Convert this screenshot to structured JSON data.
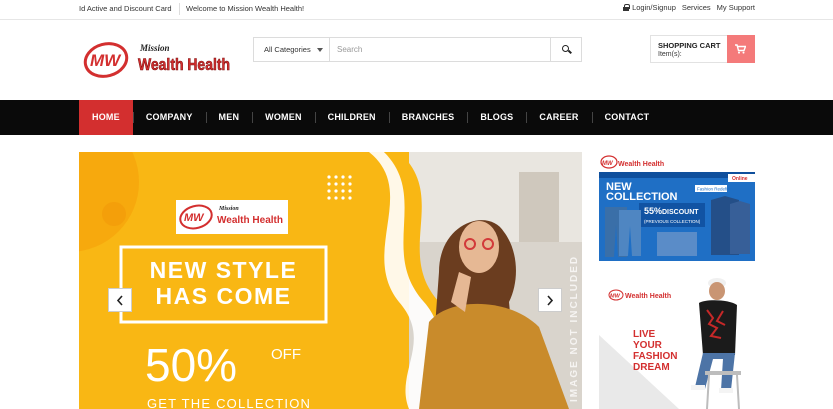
{
  "topbar": {
    "left_link": "Id Active and Discount Card",
    "welcome": "Welcome to Mission Wealth Health!",
    "login": "Login/Signup",
    "services": "Services",
    "support": "My Support"
  },
  "logo": {
    "mark": "MW",
    "small": "Mission",
    "name": "Wealth Health"
  },
  "search": {
    "category": "All Categories",
    "placeholder": "Search"
  },
  "cart": {
    "title": "SHOPPING CART",
    "items": "Item(s):"
  },
  "nav": {
    "items": [
      "HOME",
      "COMPANY",
      "MEN",
      "WOMEN",
      "CHILDREN",
      "BRANCHES",
      "BLOGS",
      "CAREER",
      "CONTACT"
    ],
    "active": "HOME"
  },
  "banner": {
    "logo_small": "Mission",
    "logo_name": "Wealth Health",
    "headline_1": "NEW STYLE",
    "headline_2": "HAS COME",
    "discount": "50%",
    "discount_suffix": "OFF",
    "cta": "GET THE COLLECTION",
    "side_text": "IMAGE NOT INCLUDED"
  },
  "side_banner_1": {
    "logo": "Wealth Health",
    "new": "NEW",
    "collection": "COLLECTION",
    "tag": "Online",
    "percent": "55%",
    "discount": "DISCOUNT",
    "note": "(PREVIOUS COLLECTION)",
    "sub": "Fashion Redefined"
  },
  "side_banner_2": {
    "logo": "Wealth Health",
    "line1": "LIVE",
    "line2": "YOUR",
    "line3": "FASHION",
    "line4": "DREAM"
  },
  "colors": {
    "accent": "#d32f2f",
    "cart": "#f47a7a",
    "banner": "#f9b714",
    "nav": "#0a0a0a"
  }
}
